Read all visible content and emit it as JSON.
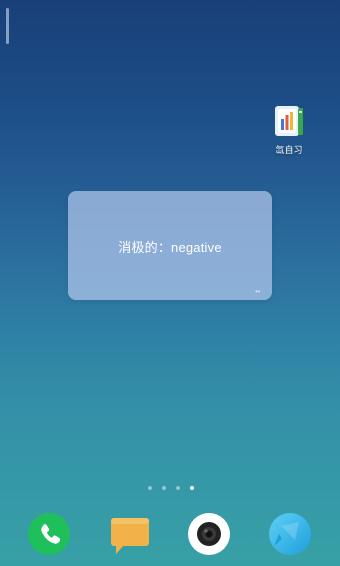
{
  "desktop": {
    "shortcuts": [
      {
        "label": "氙自习",
        "icon": "app-book-chart-icon"
      }
    ]
  },
  "widget": {
    "text": "消极的：negative",
    "corner_mark": "↔"
  },
  "pager": {
    "page_count": 4,
    "active_page": 4
  },
  "dock": {
    "apps": [
      {
        "icon": "phone-icon",
        "color": "#1fbf5b"
      },
      {
        "icon": "messages-icon",
        "color": "#f2b24a"
      },
      {
        "icon": "camera-icon",
        "color": "#ffffff"
      },
      {
        "icon": "browser-icon",
        "color": "#2fb6e8"
      }
    ]
  }
}
